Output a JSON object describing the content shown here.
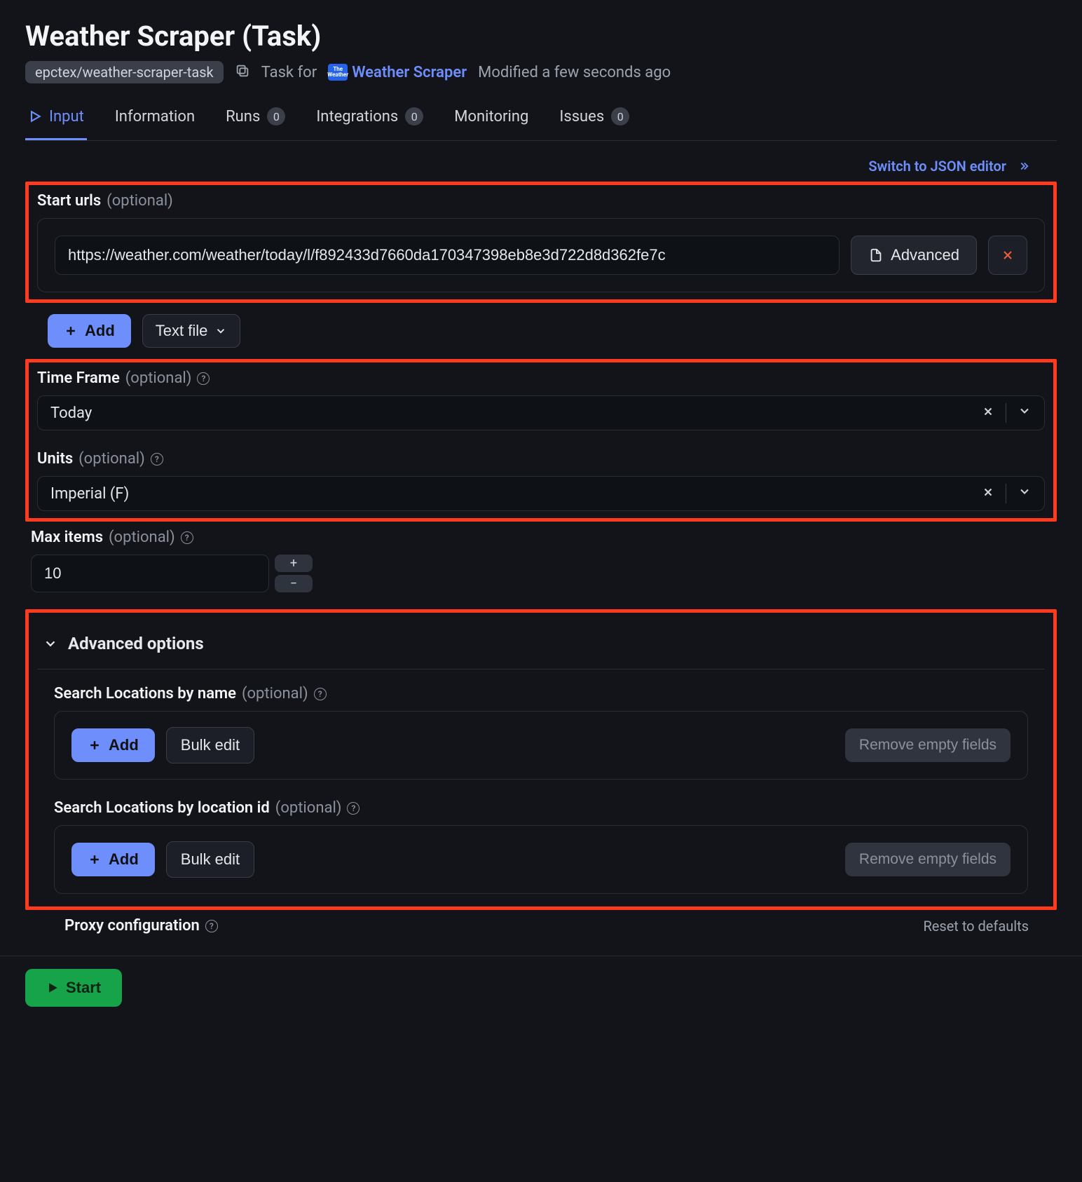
{
  "header": {
    "title": "Weather Scraper (Task)",
    "slug": "epctex/weather-scraper-task",
    "task_for_prefix": "Task for",
    "actor_name": "Weather Scraper",
    "modified": "Modified a few seconds ago"
  },
  "tabs": {
    "input": "Input",
    "information": "Information",
    "runs": "Runs",
    "runs_count": "0",
    "integrations": "Integrations",
    "integrations_count": "0",
    "monitoring": "Monitoring",
    "issues": "Issues",
    "issues_count": "0"
  },
  "json_switch": "Switch to JSON editor",
  "fields": {
    "start_urls": {
      "label": "Start urls",
      "optional": "(optional)",
      "value": "https://weather.com/weather/today/l/f892433d7660da170347398eb8e3d722d8d362fe7c",
      "advanced_btn": "Advanced",
      "add_btn": "Add",
      "text_file_btn": "Text file"
    },
    "time_frame": {
      "label": "Time Frame",
      "optional": "(optional)",
      "value": "Today"
    },
    "units": {
      "label": "Units",
      "optional": "(optional)",
      "value": "Imperial (F)"
    },
    "max_items": {
      "label": "Max items",
      "optional": "(optional)",
      "value": "10"
    },
    "advanced_section": {
      "title": "Advanced options",
      "search_name": {
        "label": "Search Locations by name",
        "optional": "(optional)",
        "add": "Add",
        "bulk": "Bulk edit",
        "remove_empty": "Remove empty fields"
      },
      "search_id": {
        "label": "Search Locations by location id",
        "optional": "(optional)",
        "add": "Add",
        "bulk": "Bulk edit",
        "remove_empty": "Remove empty fields"
      }
    },
    "proxy": {
      "label": "Proxy configuration"
    }
  },
  "reset": "Reset to defaults",
  "start_btn": "Start"
}
